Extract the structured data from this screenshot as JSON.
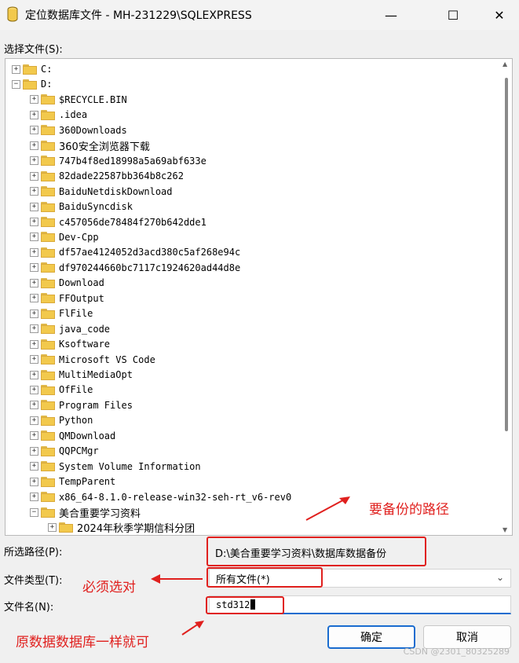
{
  "window": {
    "title": "定位数据库文件 - MH-231229\\SQLEXPRESS",
    "minimize": "—",
    "maximize": "☐",
    "close": "✕"
  },
  "labels": {
    "select_file": "选择文件(S):",
    "selected_path": "所选路径(P):",
    "file_type": "文件类型(T):",
    "file_name": "文件名(N):"
  },
  "tree": [
    {
      "label": "C:",
      "level": 0,
      "expander": "+"
    },
    {
      "label": "D:",
      "level": 0,
      "expander": "−"
    },
    {
      "label": "$RECYCLE.BIN",
      "level": 1,
      "expander": "+"
    },
    {
      "label": ".idea",
      "level": 1,
      "expander": "+"
    },
    {
      "label": "360Downloads",
      "level": 1,
      "expander": "+"
    },
    {
      "label": "360安全浏览器下载",
      "level": 1,
      "expander": "+"
    },
    {
      "label": "747b4f8ed18998a5a69abf633e",
      "level": 1,
      "expander": "+"
    },
    {
      "label": "82dade22587bb364b8c262",
      "level": 1,
      "expander": "+"
    },
    {
      "label": "BaiduNetdiskDownload",
      "level": 1,
      "expander": "+"
    },
    {
      "label": "BaiduSyncdisk",
      "level": 1,
      "expander": "+"
    },
    {
      "label": "c457056de78484f270b642dde1",
      "level": 1,
      "expander": "+"
    },
    {
      "label": "Dev-Cpp",
      "level": 1,
      "expander": "+"
    },
    {
      "label": "df57ae4124052d3acd380c5af268e94c",
      "level": 1,
      "expander": "+"
    },
    {
      "label": "df970244660bc7117c1924620ad44d8e",
      "level": 1,
      "expander": "+"
    },
    {
      "label": "Download",
      "level": 1,
      "expander": "+"
    },
    {
      "label": "FFOutput",
      "level": 1,
      "expander": "+"
    },
    {
      "label": "FlFile",
      "level": 1,
      "expander": "+"
    },
    {
      "label": "java_code",
      "level": 1,
      "expander": "+"
    },
    {
      "label": "Ksoftware",
      "level": 1,
      "expander": "+"
    },
    {
      "label": "Microsoft VS Code",
      "level": 1,
      "expander": "+"
    },
    {
      "label": "MultiMediaOpt",
      "level": 1,
      "expander": "+"
    },
    {
      "label": "OfFile",
      "level": 1,
      "expander": "+"
    },
    {
      "label": "Program Files",
      "level": 1,
      "expander": "+"
    },
    {
      "label": "Python",
      "level": 1,
      "expander": "+"
    },
    {
      "label": "QMDownload",
      "level": 1,
      "expander": "+"
    },
    {
      "label": "QQPCMgr",
      "level": 1,
      "expander": "+"
    },
    {
      "label": "System Volume Information",
      "level": 1,
      "expander": "+"
    },
    {
      "label": "TempParent",
      "level": 1,
      "expander": "+"
    },
    {
      "label": "x86_64-8.1.0-release-win32-seh-rt_v6-rev0",
      "level": 1,
      "expander": "+"
    },
    {
      "label": "美合重要学习资料",
      "level": 1,
      "expander": "−"
    },
    {
      "label": "2024年秋季学期信科分团",
      "level": 2,
      "expander": "+"
    }
  ],
  "fields": {
    "selected_path": "D:\\美合重要学习资料\\数据库数据备份",
    "file_type": "所有文件(*)",
    "file_name": "std312"
  },
  "buttons": {
    "ok": "确定",
    "cancel": "取消"
  },
  "annotations": {
    "path_note": "要备份的路径",
    "type_note": "必须选对",
    "name_note": "原数据数据库一样就可"
  },
  "watermark": "CSDN @2301_80325289",
  "colors": {
    "annotation": "#e0201e",
    "primary_button_border": "#1a6ccf"
  }
}
